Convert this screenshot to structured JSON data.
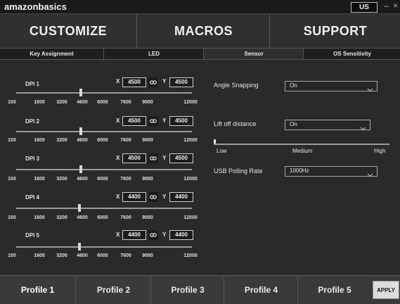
{
  "app": {
    "brand": "amazonbasics",
    "language": "US",
    "minimize": "–",
    "close": "×"
  },
  "main_nav": [
    "CUSTOMIZE",
    "MACROS",
    "SUPPORT"
  ],
  "sub_nav": [
    "Key Assignment",
    "LED",
    "Sensor",
    "OS Sensitivity"
  ],
  "sub_nav_active": "Sensor",
  "dpi_ticks": [
    "100",
    "1600",
    "3200",
    "4600",
    "6000",
    "7600",
    "9000",
    "12000"
  ],
  "dpi_levels": [
    {
      "label": "DPI 1",
      "x_label": "X",
      "y_label": "Y",
      "x": "4500",
      "y": "4500",
      "slider_value": 4500
    },
    {
      "label": "DPI 2",
      "x_label": "X",
      "y_label": "Y",
      "x": "4500",
      "y": "4500",
      "slider_value": 4500
    },
    {
      "label": "DPI 3",
      "x_label": "X",
      "y_label": "Y",
      "x": "4500",
      "y": "4500",
      "slider_value": 4500
    },
    {
      "label": "DPI 4",
      "x_label": "X",
      "y_label": "Y",
      "x": "4400",
      "y": "4400",
      "slider_value": 4400
    },
    {
      "label": "DPI 5",
      "x_label": "X",
      "y_label": "Y",
      "x": "4400",
      "y": "4400",
      "slider_value": 4400
    }
  ],
  "sensor_options": {
    "angle_snapping": {
      "label": "Angle Snapping",
      "value": "On"
    },
    "lift_off_distance": {
      "label": "Lift off distance",
      "value": "On",
      "slider_labels": [
        "Low",
        "Medium",
        "High"
      ],
      "slider_position": 0
    },
    "usb_polling_rate": {
      "label": "USB Polling Rate",
      "value": "1000Hz"
    }
  },
  "profiles": [
    "Profile 1",
    "Profile 2",
    "Profile 3",
    "Profile 4",
    "Profile 5"
  ],
  "active_profile": "Profile 1",
  "apply_label": "APPLY"
}
